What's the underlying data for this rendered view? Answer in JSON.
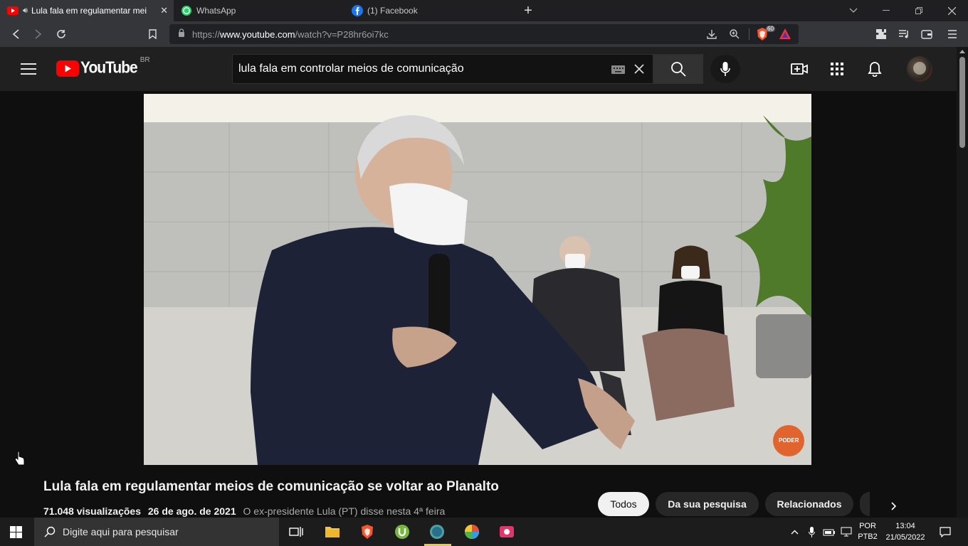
{
  "browser": {
    "tabs": [
      {
        "title": "Lula fala em regulamentar mei",
        "close": "✕"
      },
      {
        "title": "WhatsApp"
      },
      {
        "title": "(1) Facebook"
      }
    ],
    "new_tab": "+",
    "url_prefix": "https://",
    "url_domain": "www.youtube.com",
    "url_path": "/watch?v=P28hr6oi7kc",
    "brave_shield_count": "60"
  },
  "youtube": {
    "logo_text": "YouTube",
    "country": "BR",
    "search_query": "lula fala em controlar meios de comunicação",
    "video_title": "Lula fala em regulamentar meios de comunicação se voltar ao Planalto",
    "views": "71.048 visualizações",
    "date": "26 de ago. de 2021",
    "description": "O ex-presidente Lula (PT) disse nesta 4ª feira",
    "watermark": "PODER",
    "chips": [
      "Todos",
      "Da sua pesquisa",
      "Relacionados"
    ],
    "colors": {
      "brand_red": "#ff0000",
      "bg": "#0f0f0f"
    }
  },
  "taskbar": {
    "search_placeholder": "Digite aqui para pesquisar",
    "language": "POR",
    "layout": "PTB2",
    "time": "13:04",
    "date": "21/05/2022"
  }
}
